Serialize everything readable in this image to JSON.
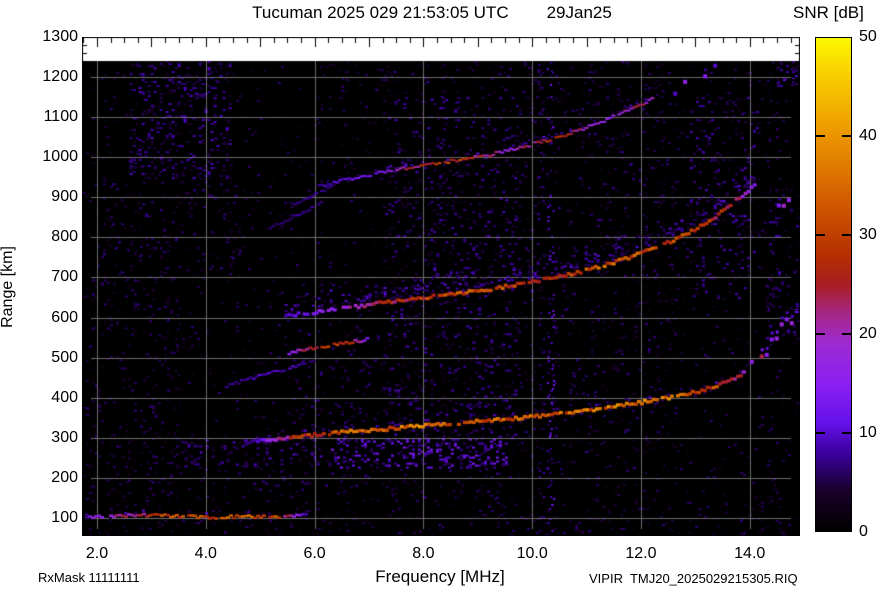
{
  "title": {
    "station_time": "Tucuman 2025 029 21:53:05 UTC",
    "date": "29Jan25"
  },
  "colorbar": {
    "label": "SNR [dB]",
    "ticks": [
      0,
      10,
      20,
      30,
      40,
      50
    ]
  },
  "axes": {
    "x_label": "Frequency [MHz]",
    "y_label": "Range [km]"
  },
  "footer": {
    "rx_mask": "RxMask 11111111",
    "file_name": "VIPIR  TMJ20_2025029215305.RIQ"
  },
  "chart_data": {
    "type": "heatmap",
    "title": "Tucuman 2025 029 21:53:05 UTC 29Jan25",
    "xlabel": "Frequency [MHz]",
    "ylabel": "Range [km]",
    "zlabel": "SNR [dB]",
    "xlim": [
      1.724,
      14.924
    ],
    "ylim": [
      55,
      1300
    ],
    "zlim": [
      0,
      50
    ],
    "x_ticks": [
      2,
      4,
      6,
      8,
      10,
      12,
      14
    ],
    "x_tick_labels": [
      "2.0",
      "4.0",
      "6.0",
      "8.0",
      "10.0",
      "12.0",
      "14.0"
    ],
    "y_ticks": [
      100,
      200,
      300,
      400,
      500,
      600,
      700,
      800,
      900,
      1000,
      1100,
      1200,
      1300
    ],
    "colorbar_ticks": [
      0,
      10,
      20,
      30,
      40,
      50
    ],
    "grid": true,
    "data_top_km": 1240,
    "colormap_stops": [
      [
        0.0,
        "#000000"
      ],
      [
        0.08,
        "#180028"
      ],
      [
        0.16,
        "#3c00a0"
      ],
      [
        0.22,
        "#6512ea"
      ],
      [
        0.3,
        "#8b20f2"
      ],
      [
        0.38,
        "#9e2ad2"
      ],
      [
        0.44,
        "#a52787"
      ],
      [
        0.5,
        "#a81e22"
      ],
      [
        0.56,
        "#b52f00"
      ],
      [
        0.64,
        "#cb4f00"
      ],
      [
        0.8,
        "#ec9400"
      ],
      [
        0.92,
        "#f8cc00"
      ],
      [
        1.0,
        "#fdf800"
      ]
    ],
    "traces": [
      {
        "name": "E-layer echo ~100-108 km",
        "style": "solid",
        "width_km": 6,
        "halo_km": 6,
        "halo_side": "both",
        "points": [
          [
            1.78,
            102,
            13
          ],
          [
            2.2,
            106,
            19
          ],
          [
            2.7,
            108,
            23
          ],
          [
            3.1,
            106,
            29
          ],
          [
            3.6,
            103,
            31
          ],
          [
            4.2,
            102,
            32
          ],
          [
            4.9,
            103,
            32
          ],
          [
            5.3,
            104,
            29
          ],
          [
            5.6,
            106,
            18
          ],
          [
            5.85,
            108,
            8
          ]
        ]
      },
      {
        "name": "oblique echo 430-490 km",
        "style": "solid",
        "width_km": 4,
        "halo_km": 0,
        "halo_side": "none",
        "points": [
          [
            4.35,
            430,
            7
          ],
          [
            4.9,
            452,
            9
          ],
          [
            5.5,
            474,
            9
          ],
          [
            5.95,
            492,
            7
          ]
        ]
      },
      {
        "name": "echo streak ~515-545 km",
        "style": "solid",
        "width_km": 6,
        "halo_km": 4,
        "halo_side": "both",
        "points": [
          [
            5.5,
            512,
            14
          ],
          [
            5.85,
            522,
            24
          ],
          [
            6.25,
            531,
            29
          ],
          [
            6.65,
            539,
            25
          ],
          [
            6.95,
            546,
            12
          ]
        ]
      },
      {
        "name": "F-layer 1st hop main trace",
        "style": "solid",
        "width_km": 8,
        "halo_km": 10,
        "halo_side": "both",
        "points": [
          [
            4.7,
            289,
            7
          ],
          [
            5.0,
            293,
            11
          ],
          [
            5.3,
            298,
            20
          ],
          [
            5.7,
            304,
            27
          ],
          [
            6.1,
            309,
            31
          ],
          [
            6.6,
            315,
            33
          ],
          [
            7.2,
            321,
            33
          ],
          [
            7.8,
            328,
            35
          ],
          [
            8.4,
            335,
            36
          ],
          [
            9.0,
            341,
            34
          ],
          [
            9.6,
            348,
            32
          ],
          [
            10.2,
            356,
            33
          ],
          [
            10.8,
            365,
            34
          ],
          [
            11.4,
            376,
            35
          ],
          [
            12.0,
            389,
            36
          ],
          [
            12.5,
            401,
            34
          ],
          [
            13.0,
            415,
            33
          ],
          [
            13.35,
            429,
            30
          ],
          [
            13.65,
            446,
            26
          ],
          [
            13.9,
            464,
            21
          ]
        ]
      },
      {
        "name": "1st hop asymptotic riser",
        "style": "scatter",
        "width_km": 6,
        "halo_km": 0,
        "halo_side": "none",
        "points": [
          [
            14.0,
            480,
            18
          ],
          [
            14.15,
            502,
            22
          ],
          [
            14.3,
            528,
            15
          ],
          [
            14.45,
            556,
            21
          ],
          [
            14.6,
            582,
            13
          ],
          [
            14.72,
            602,
            17
          ],
          [
            14.85,
            622,
            11
          ]
        ]
      },
      {
        "name": "F-layer 2nd hop trace",
        "style": "solid",
        "width_km": 8,
        "halo_km": 55,
        "halo_side": "above",
        "points": [
          [
            5.45,
            604,
            9
          ],
          [
            5.9,
            612,
            13
          ],
          [
            6.4,
            621,
            17
          ],
          [
            6.9,
            631,
            21
          ],
          [
            7.4,
            640,
            25
          ],
          [
            8.0,
            650,
            29
          ],
          [
            8.6,
            660,
            31
          ],
          [
            9.2,
            671,
            30
          ],
          [
            9.8,
            684,
            29
          ],
          [
            10.4,
            700,
            30
          ],
          [
            11.0,
            719,
            31
          ],
          [
            11.6,
            743,
            32
          ],
          [
            12.1,
            767,
            30
          ],
          [
            12.6,
            795,
            29
          ],
          [
            13.0,
            823,
            30
          ],
          [
            13.4,
            857,
            27
          ],
          [
            13.7,
            890,
            23
          ],
          [
            13.95,
            918,
            16
          ],
          [
            14.1,
            940,
            10
          ]
        ]
      },
      {
        "name": "2nd hop right-edge scatter",
        "style": "scatter",
        "width_km": 5,
        "halo_km": 0,
        "halo_side": "none",
        "points": [
          [
            14.5,
            872,
            12
          ],
          [
            14.65,
            898,
            18
          ],
          [
            14.8,
            922,
            14
          ],
          [
            14.9,
            940,
            10
          ]
        ]
      },
      {
        "name": "F-layer 3rd hop trace",
        "style": "solid",
        "width_km": 5,
        "halo_km": 14,
        "halo_side": "above",
        "points": [
          [
            6.05,
            928,
            7
          ],
          [
            6.5,
            943,
            11
          ],
          [
            7.0,
            957,
            13
          ],
          [
            7.45,
            968,
            17
          ],
          [
            8.0,
            981,
            27
          ],
          [
            8.6,
            993,
            28
          ],
          [
            9.2,
            1006,
            22
          ],
          [
            9.6,
            1021,
            17
          ],
          [
            10.0,
            1033,
            24
          ],
          [
            10.35,
            1046,
            27
          ],
          [
            10.7,
            1060,
            24
          ],
          [
            11.0,
            1077,
            18
          ],
          [
            11.3,
            1092,
            17
          ],
          [
            11.6,
            1110,
            16
          ],
          [
            11.9,
            1127,
            24
          ],
          [
            12.2,
            1147,
            18
          ]
        ]
      },
      {
        "name": "3rd hop tail scatter",
        "style": "scatter",
        "width_km": 4,
        "halo_km": 0,
        "halo_side": "none",
        "points": [
          [
            12.5,
            1168,
            13
          ],
          [
            12.8,
            1190,
            15
          ],
          [
            13.1,
            1212,
            12
          ],
          [
            13.35,
            1233,
            13
          ]
        ]
      },
      {
        "name": "faint pre-echo streak 1",
        "style": "solid",
        "width_km": 4,
        "halo_km": 0,
        "halo_side": "none",
        "points": [
          [
            5.15,
            823,
            6
          ],
          [
            5.7,
            860,
            8
          ],
          [
            6.1,
            886,
            7
          ]
        ]
      },
      {
        "name": "faint pre-echo streak 2",
        "style": "solid",
        "width_km": 4,
        "halo_km": 0,
        "halo_side": "none",
        "points": [
          [
            5.55,
            878,
            6
          ],
          [
            6.0,
            910,
            8
          ],
          [
            6.35,
            932,
            6
          ]
        ]
      }
    ],
    "noise": {
      "seed": 1337,
      "base_density": 0.03,
      "base_snr": [
        1.5,
        6.5
      ],
      "regions": [
        [
          1.724,
          14.924,
          55,
          100,
          0.06,
          1.5,
          6.5
        ],
        [
          1.724,
          14.924,
          100,
          150,
          0.04,
          1.5,
          6.0
        ],
        [
          2.6,
          4.45,
          950,
          1245,
          0.18,
          2.5,
          9.5
        ],
        [
          2.0,
          4.6,
          700,
          950,
          0.07,
          2.0,
          7.5
        ],
        [
          3.5,
          6.3,
          228,
          296,
          0.14,
          3.0,
          10.0
        ],
        [
          6.3,
          9.55,
          228,
          298,
          0.26,
          5.0,
          14.0
        ],
        [
          3.6,
          9.5,
          150,
          228,
          0.06,
          2.0,
          7.5
        ],
        [
          7.3,
          9.7,
          298,
          560,
          0.1,
          2.5,
          9.5
        ],
        [
          7.3,
          9.7,
          560,
          1150,
          0.085,
          2.5,
          9.0
        ],
        [
          9.7,
          12.65,
          200,
          1150,
          0.04,
          2.0,
          7.5
        ],
        [
          12.9,
          14.15,
          650,
          1150,
          0.085,
          2.5,
          9.5
        ],
        [
          14.3,
          14.924,
          550,
          950,
          0.07,
          2.5,
          9.5
        ],
        [
          14.5,
          14.924,
          1180,
          1245,
          0.22,
          4.0,
          11.0
        ],
        [
          1.724,
          3.5,
          150,
          700,
          0.045,
          2.0,
          7.0
        ],
        [
          5.6,
          7.3,
          300,
          620,
          0.05,
          2.0,
          8.0
        ],
        [
          6.4,
          12.4,
          1150,
          1245,
          0.05,
          2.0,
          7.5
        ]
      ],
      "stripes": [
        [
          3.48,
          0.05,
          0.14,
          2.0,
          6.0
        ],
        [
          6.08,
          0.05,
          0.12,
          2.5,
          7.0
        ],
        [
          6.55,
          0.05,
          0.1,
          2.0,
          6.5
        ],
        [
          8.33,
          0.05,
          0.12,
          3.0,
          8.0
        ],
        [
          9.75,
          0.05,
          0.1,
          3.0,
          7.0
        ],
        [
          10.15,
          0.05,
          0.18,
          3.0,
          9.0
        ],
        [
          10.33,
          0.06,
          0.42,
          5.0,
          13.0
        ],
        [
          11.06,
          0.05,
          0.12,
          3.0,
          8.0
        ],
        [
          12.08,
          0.05,
          0.14,
          3.0,
          8.0
        ],
        [
          12.33,
          0.05,
          0.12,
          3.0,
          8.0
        ],
        [
          13.18,
          0.05,
          0.12,
          3.0,
          8.0
        ],
        [
          14.37,
          0.05,
          0.12,
          3.0,
          8.0
        ]
      ]
    }
  }
}
